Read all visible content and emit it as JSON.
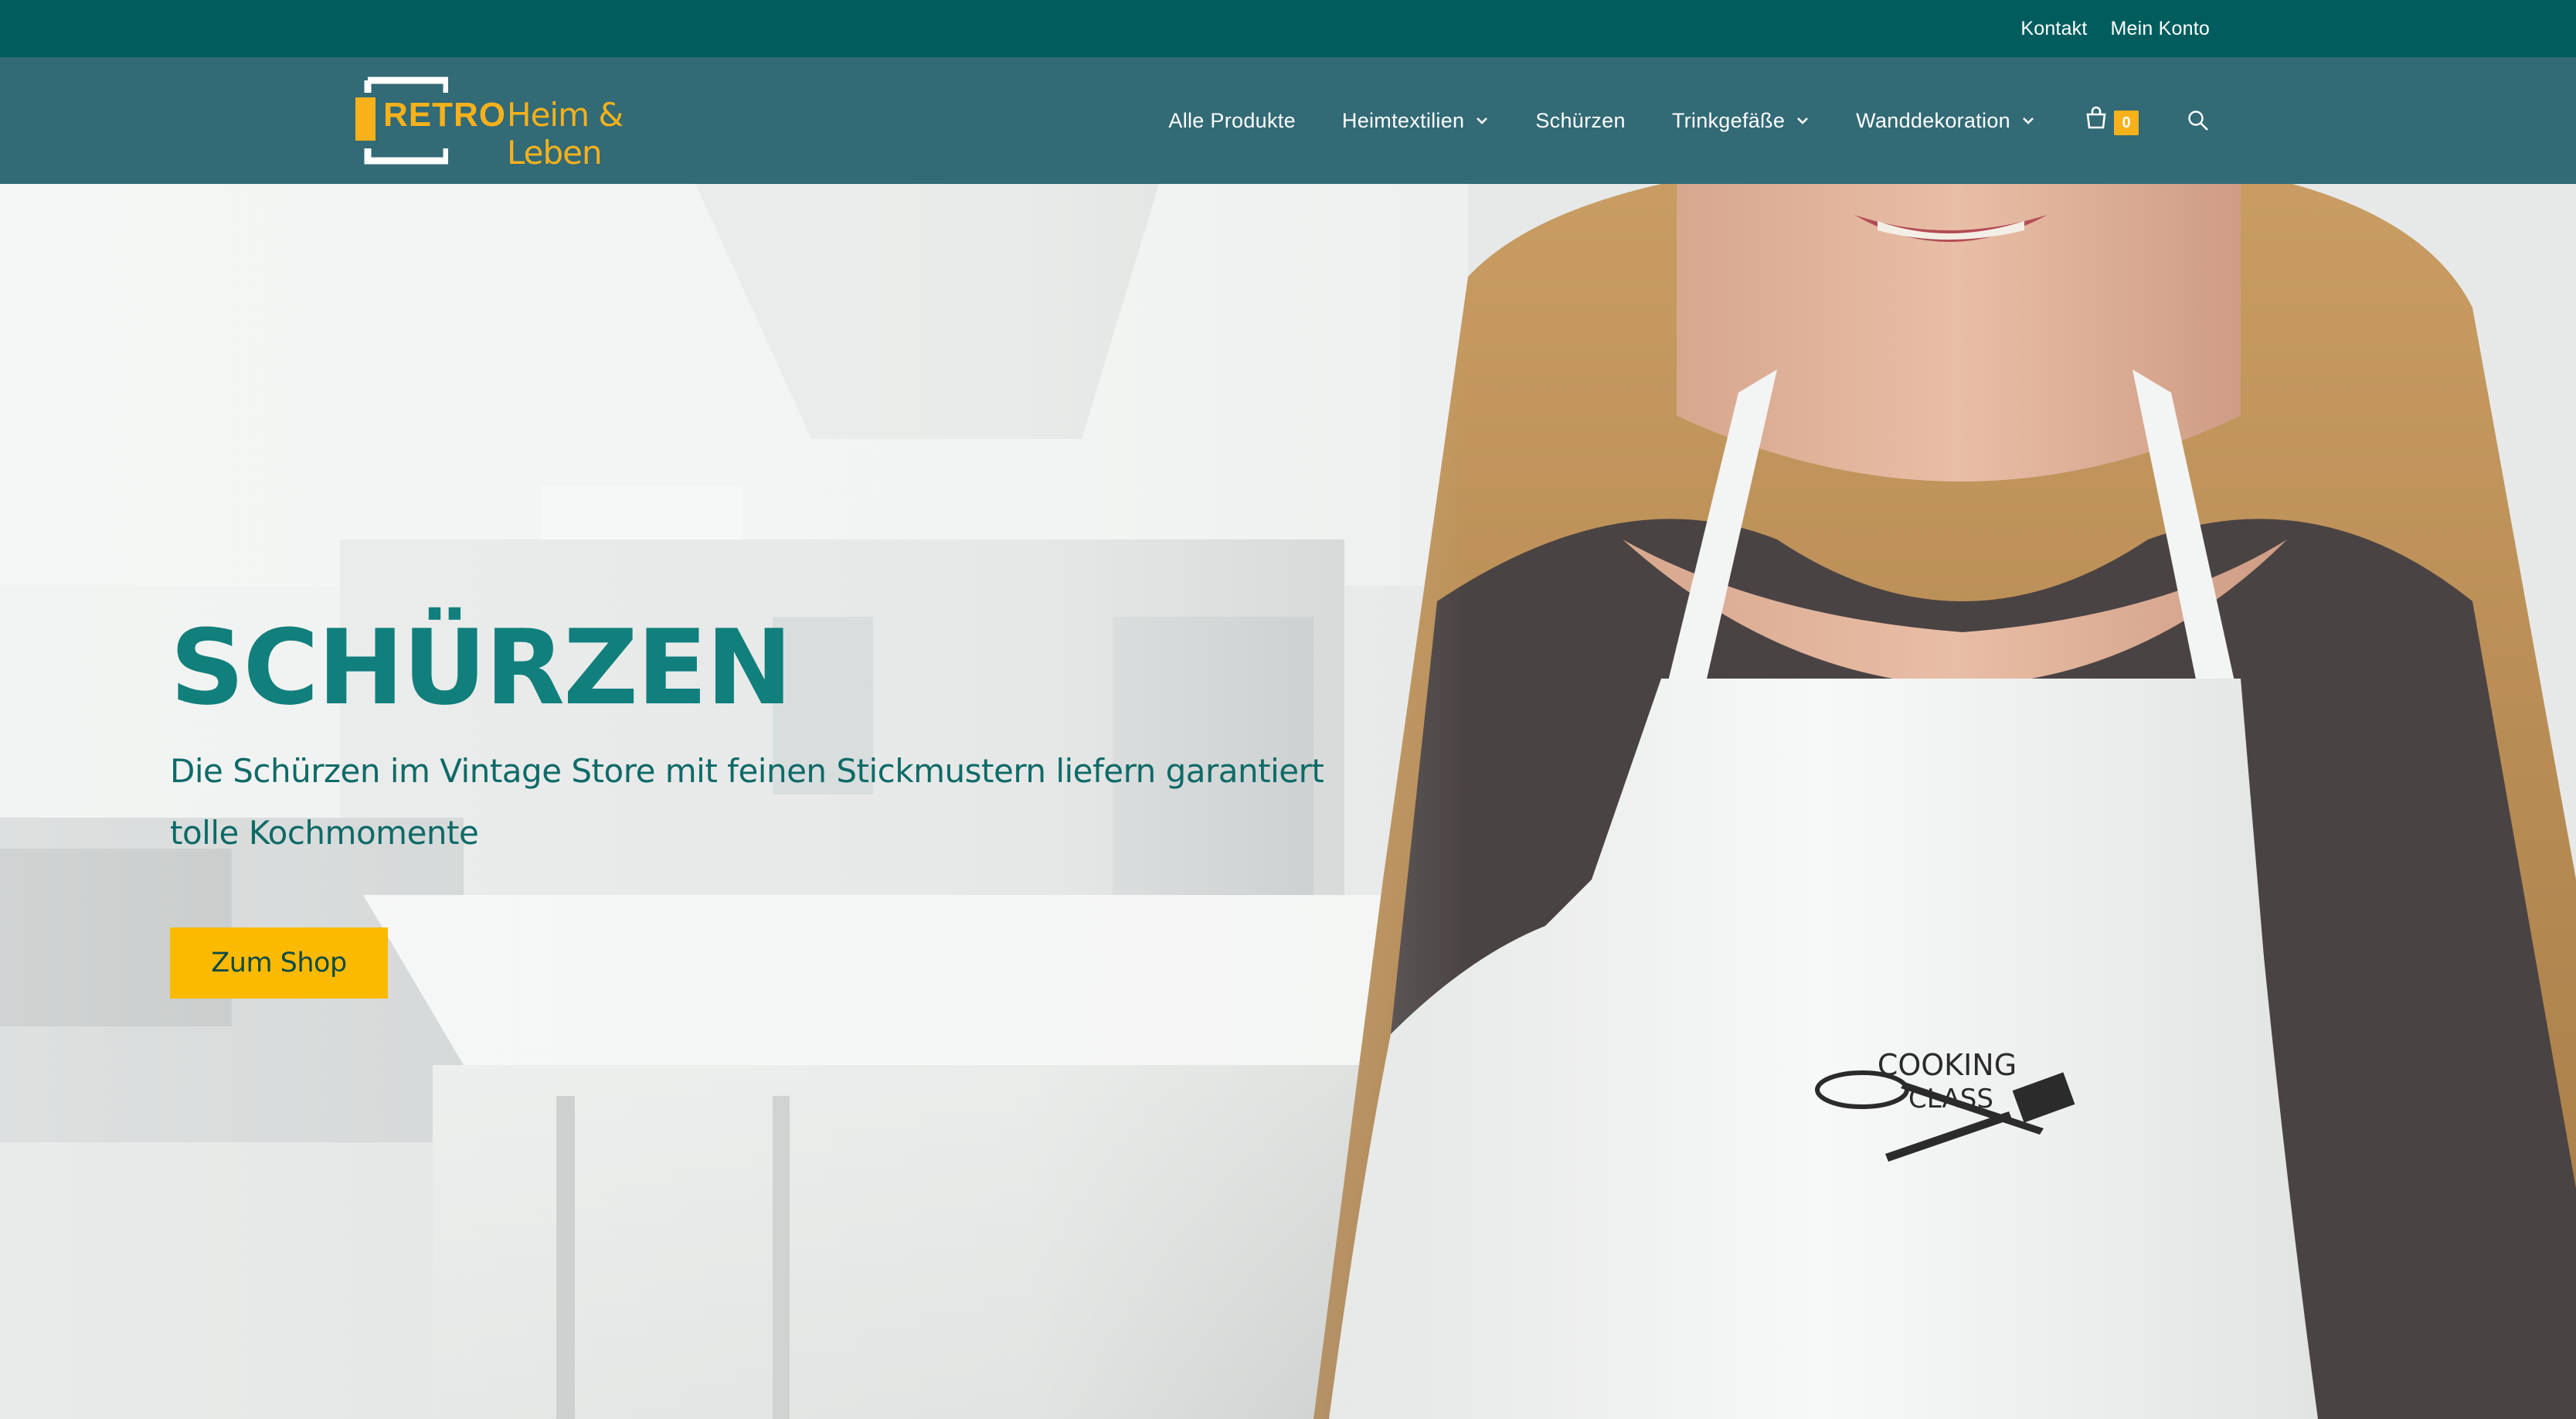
{
  "topbar": {
    "links": [
      "Kontakt",
      "Mein Konto"
    ]
  },
  "logo": {
    "word1": "RETRO",
    "word2": "Heim & Leben",
    "color": "#f6b11b"
  },
  "nav": {
    "items": [
      {
        "label": "Alle Produkte",
        "dropdown": false
      },
      {
        "label": "Heimtextilien",
        "dropdown": true
      },
      {
        "label": "Schürzen",
        "dropdown": false
      },
      {
        "label": "Trinkgefäße",
        "dropdown": true
      },
      {
        "label": "Wanddekoration",
        "dropdown": true
      }
    ],
    "cart_count": "0",
    "icons": [
      "shopping-bag-icon",
      "search-icon",
      "chevron-down-icon"
    ]
  },
  "hero": {
    "title": "SCHÜRZEN",
    "subtitle": "Die Schürzen im Vintage Store mit feinen Stickmustern liefern garantiert tolle Kochmomente",
    "button": "Zum Shop",
    "apron_print_line1": "COOKING",
    "apron_print_line2": "CLASS"
  },
  "colors": {
    "topbar": "#015c5e",
    "header": "#326a76",
    "accent": "#fbba00",
    "title": "#117f7c"
  }
}
